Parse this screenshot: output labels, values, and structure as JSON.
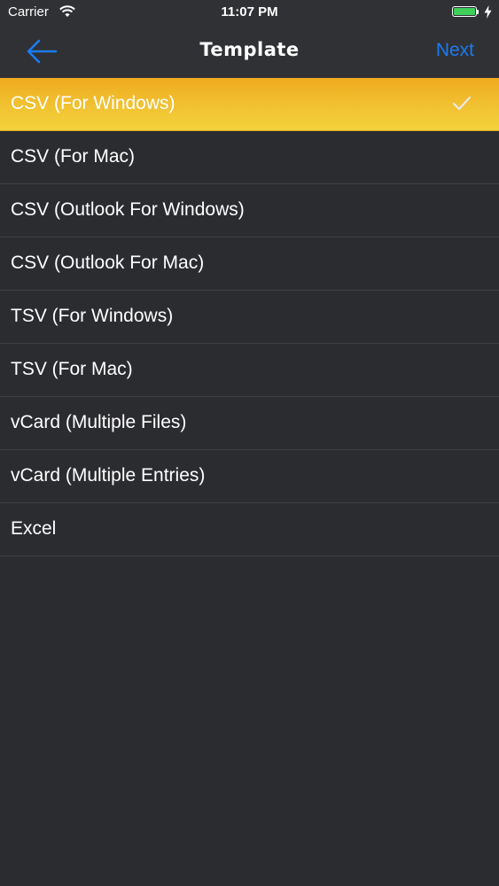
{
  "status_bar": {
    "carrier": "Carrier",
    "time": "11:07 PM",
    "battery_level": 1.0,
    "battery_color": "#3ed05a",
    "icons": [
      "wifi-icon",
      "battery-icon",
      "charging-bolt-icon"
    ]
  },
  "nav": {
    "back_icon": "arrow-left-icon",
    "title": "Template",
    "next_label": "Next",
    "accent_color": "#1a7cf2"
  },
  "templates": {
    "selected_index": 0,
    "selected_color": "#f1c232",
    "check_icon": "checkmark-icon",
    "items": [
      "CSV (For Windows)",
      "CSV (For Mac)",
      "CSV (Outlook For Windows)",
      "CSV (Outlook For Mac)",
      "TSV (For Windows)",
      "TSV (For Mac)",
      "vCard (Multiple Files)",
      "vCard (Multiple Entries)",
      "Excel"
    ]
  }
}
